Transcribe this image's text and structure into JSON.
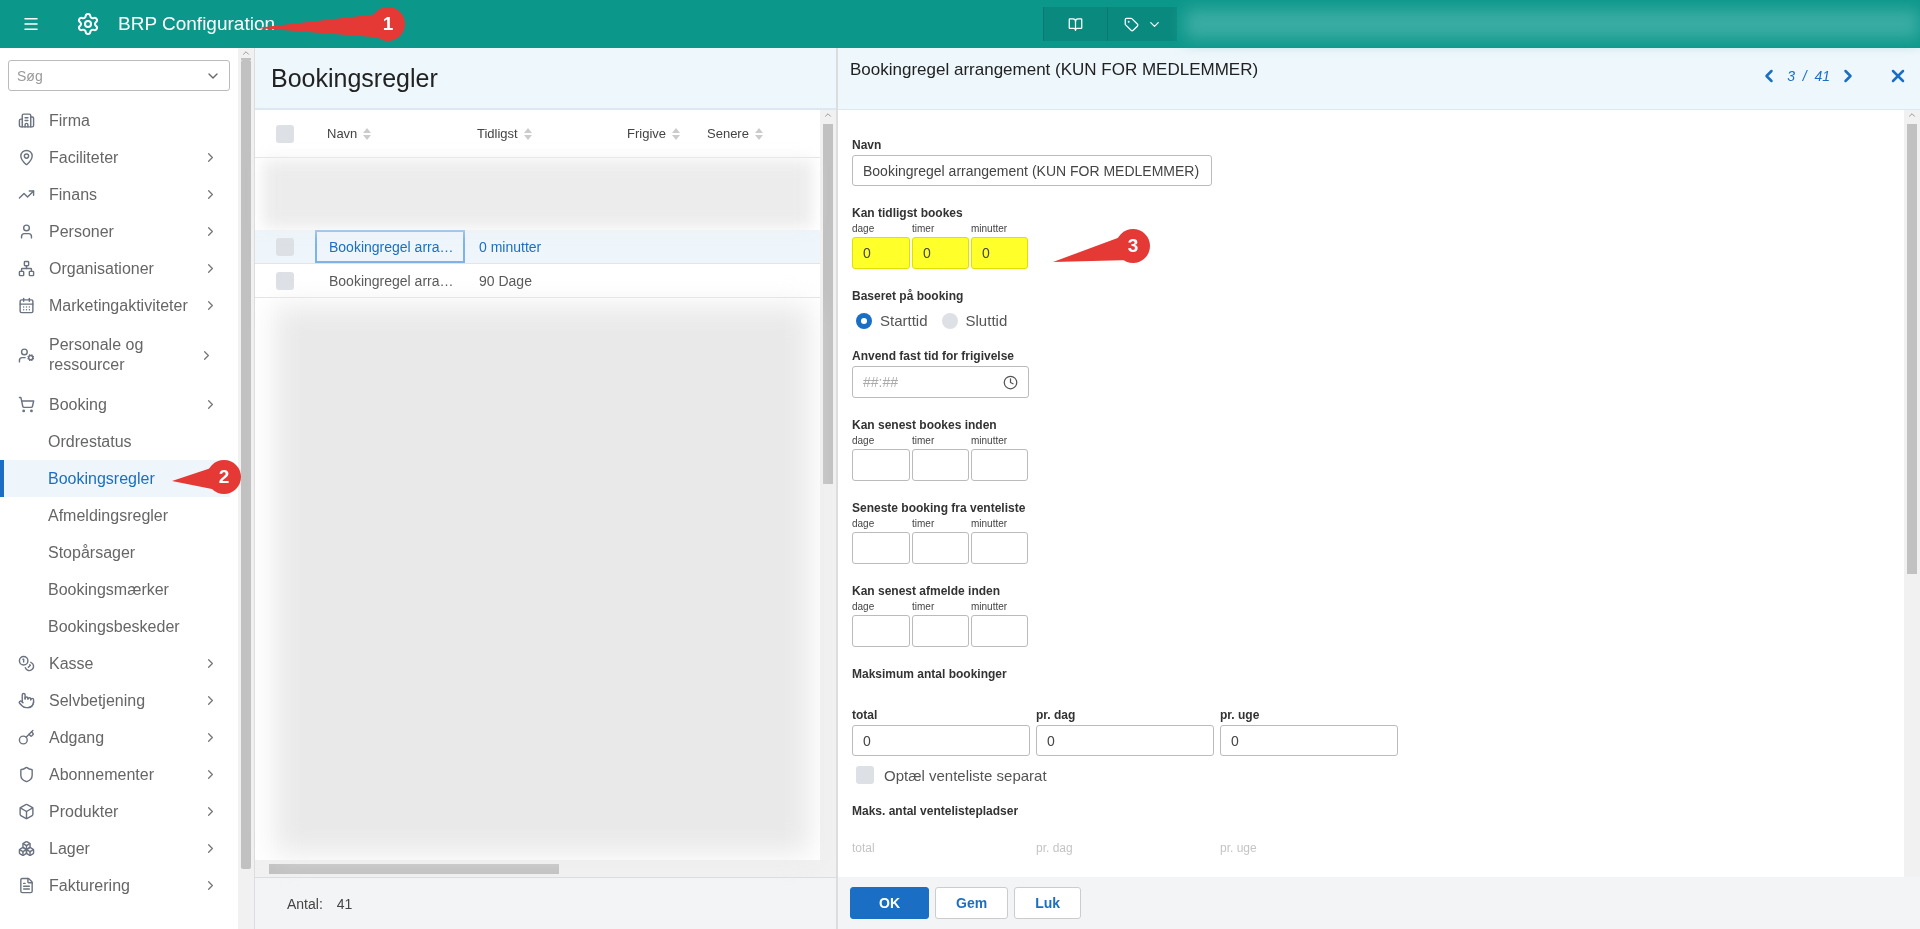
{
  "topbar": {
    "title": "BRP Configuration"
  },
  "sidebar": {
    "search": {
      "placeholder": "Søg"
    },
    "items": [
      {
        "label": "Firma",
        "selected": false,
        "has_submenu": false
      },
      {
        "label": "Faciliteter",
        "selected": false,
        "has_submenu": true
      },
      {
        "label": "Finans",
        "selected": false,
        "has_submenu": true
      },
      {
        "label": "Personer",
        "selected": false,
        "has_submenu": true
      },
      {
        "label": "Organisationer",
        "selected": false,
        "has_submenu": true
      },
      {
        "label": "Marketingaktiviteter",
        "selected": false,
        "has_submenu": true
      },
      {
        "label": "Personale og ressourcer",
        "selected": false,
        "has_submenu": true
      },
      {
        "label": "Booking",
        "selected": false,
        "has_submenu": true,
        "children": [
          {
            "label": "Ordrestatus",
            "selected": false
          },
          {
            "label": "Bookingsregler",
            "selected": true
          },
          {
            "label": "Afmeldingsregler",
            "selected": false
          },
          {
            "label": "Stopårsager",
            "selected": false
          },
          {
            "label": "Bookingsmærker",
            "selected": false
          },
          {
            "label": "Bookingsbeskeder",
            "selected": false
          }
        ]
      },
      {
        "label": "Kasse",
        "selected": false,
        "has_submenu": true
      },
      {
        "label": "Selvbetjening",
        "selected": false,
        "has_submenu": true
      },
      {
        "label": "Adgang",
        "selected": false,
        "has_submenu": true
      },
      {
        "label": "Abonnementer",
        "selected": false,
        "has_submenu": true
      },
      {
        "label": "Produkter",
        "selected": false,
        "has_submenu": true
      },
      {
        "label": "Lager",
        "selected": false,
        "has_submenu": true
      },
      {
        "label": "Fakturering",
        "selected": false,
        "has_submenu": true
      }
    ]
  },
  "list": {
    "title": "Bookingsregler",
    "header_checkbox": {
      "checked": false
    },
    "columns": [
      {
        "label": "Navn"
      },
      {
        "label": "Tidligst"
      },
      {
        "label": "Frigive"
      },
      {
        "label": "Senere"
      }
    ],
    "rows": [
      {
        "cells": [
          "Bookingregel arra…",
          "0 minutter"
        ],
        "selected": true,
        "checked": false
      },
      {
        "cells": [
          "Bookingregel arra…",
          "90 Dage"
        ],
        "selected": false,
        "checked": false
      }
    ],
    "footer": {
      "label": "Antal:",
      "value": "41"
    }
  },
  "detail": {
    "title": "Bookingregel arrangement (KUN FOR MEDLEMMER)",
    "pager": {
      "current": "3",
      "separator": "/",
      "total": "41"
    },
    "sections": [
      {
        "kind": "text",
        "label": "Navn",
        "value": "Bookingregel arrangement (KUN FOR MEDLEMMER)"
      },
      {
        "kind": "duration",
        "label": "Kan tidligst bookes",
        "highlighted": true,
        "fields": [
          {
            "label": "dage",
            "value": "0"
          },
          {
            "label": "timer",
            "value": "0"
          },
          {
            "label": "minutter",
            "value": "0"
          }
        ]
      },
      {
        "kind": "radio",
        "label": "Baseret på booking",
        "options": [
          {
            "label": "Starttid",
            "selected": true
          },
          {
            "label": "Sluttid",
            "selected": false
          }
        ]
      },
      {
        "kind": "time",
        "label": "Anvend fast tid for frigivelse",
        "placeholder": "##:##"
      },
      {
        "kind": "duration",
        "label": "Kan senest bookes inden",
        "highlighted": false,
        "fields": [
          {
            "label": "dage"
          },
          {
            "label": "timer"
          },
          {
            "label": "minutter"
          }
        ]
      },
      {
        "kind": "duration",
        "label": "Seneste booking fra venteliste",
        "highlighted": false,
        "fields": [
          {
            "label": "dage"
          },
          {
            "label": "timer"
          },
          {
            "label": "minutter"
          }
        ]
      },
      {
        "kind": "duration",
        "label": "Kan senest afmelde inden",
        "highlighted": false,
        "fields": [
          {
            "label": "dage"
          },
          {
            "label": "timer"
          },
          {
            "label": "minutter"
          }
        ]
      },
      {
        "kind": "counts",
        "label": "Maksimum antal bookinger",
        "fields": [
          {
            "label": "total",
            "value": "0"
          },
          {
            "label": "pr. dag",
            "value": "0"
          },
          {
            "label": "pr. uge",
            "value": "0"
          }
        ],
        "checkbox": {
          "label": "Optæl venteliste separat",
          "checked": false
        }
      },
      {
        "kind": "count_labels",
        "label": "Maks. antal ventelistepladser",
        "disabled": true,
        "fields": [
          {
            "label": "total"
          },
          {
            "label": "pr. dag"
          },
          {
            "label": "pr. uge"
          }
        ]
      }
    ],
    "buttons": [
      {
        "label": "OK",
        "kind": "primary"
      },
      {
        "label": "Gem",
        "kind": "secondary"
      },
      {
        "label": "Luk",
        "kind": "secondary"
      }
    ]
  },
  "callouts": [
    {
      "number": "1"
    },
    {
      "number": "2"
    },
    {
      "number": "3"
    }
  ]
}
